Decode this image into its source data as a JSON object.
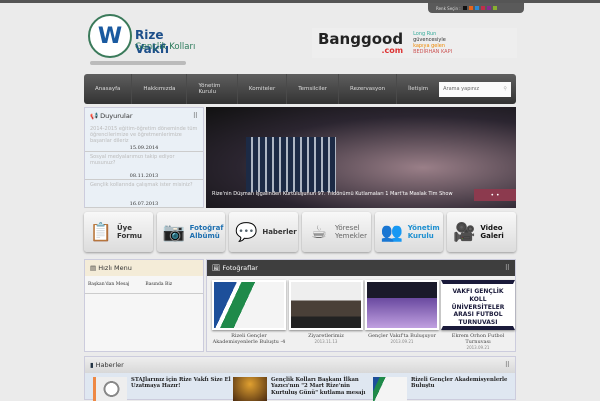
{
  "header": {
    "color_label": "Renk Seçin :",
    "swatches": [
      "#111111",
      "#e8641b",
      "#2a8ad6",
      "#c0304a",
      "#8a2a90",
      "#8ab030"
    ],
    "logo_title": "Rize Vakfı",
    "logo_subtitle": "Gençlik Kolları",
    "ad_brand": "Banggood",
    "ad_domain": ".com",
    "ad_slogan": [
      "Long Run",
      "güvencesiyle",
      "kapıya gelen",
      "BEDİRHAN KAPI"
    ]
  },
  "nav": {
    "items": [
      "Anasayfa",
      "Hakkımızda",
      "Yönetim Kurulu",
      "Komiteler",
      "Temsilciler",
      "Rezervasyon",
      "İletişim"
    ],
    "search_placeholder": "Arama yapınız"
  },
  "announcements": {
    "title": "Duyurular",
    "items": [
      {
        "text": "2014-2015 eğitim-öğretim döneminde tüm öğrencilerimize ve öğretmenlerimize başarılar dileriz",
        "date": "15.09.2014"
      },
      {
        "text": "Sosyal medyalarımızı takip ediyor musunuz?",
        "date": "08.11.2013"
      },
      {
        "text": "Gençlik kollarında çalışmak ister misiniz?",
        "date": "16.07.2013"
      }
    ]
  },
  "slider": {
    "caption": "Rize'nin Düşman İşgalinden Kurtuluşunun 97. Yıldönümü Kutlamaları 1 Mart'ta Maslak Tim Show",
    "dots": "• •"
  },
  "quick_buttons": [
    {
      "l1": "Üye",
      "l2": "Formu",
      "icon": "form-icon",
      "glyph": "📋",
      "color": "#333"
    },
    {
      "l1": "Fotoğraf",
      "l2": "Albümü",
      "icon": "camera-icon",
      "glyph": "📷",
      "color": "#1d6fb0"
    },
    {
      "l1": "Haberler",
      "l2": "",
      "icon": "news-bubble-icon",
      "glyph": "💬",
      "color": "#333"
    },
    {
      "l1": "Yöresel",
      "l2": "Yemekler",
      "icon": "tea-cup-icon",
      "glyph": "☕",
      "color": "#666"
    },
    {
      "l1": "Yönetim",
      "l2": "Kurulu",
      "icon": "people-icon",
      "glyph": "👥",
      "color": "#1d8fd0"
    },
    {
      "l1": "Video",
      "l2": "Galeri",
      "icon": "video-camera-icon",
      "glyph": "🎥",
      "color": "#111"
    }
  ],
  "quick_menu": {
    "title": "Hızlı Menu",
    "links": [
      "Başkan'dan Mesaj",
      "Basında Biz"
    ]
  },
  "photos": {
    "title": "Fotoğraflar",
    "items": [
      {
        "title": "Rizeli Gençler Akademisyenlerle Buluştu -4",
        "date": ""
      },
      {
        "title": "Ziyaretlerimiz",
        "date": "2013.11.13"
      },
      {
        "title": "Gençler Vakıf'ta Buluşuyor",
        "date": "2013.09.21"
      },
      {
        "title": "Ekrem Orhon Futbol Turnuvası",
        "date": "2013.09.21"
      }
    ],
    "banner_text": "VAKFI GENÇLİK KOLL ÜNİVERSİTELER ARASI FUTBOL TURNUVASI"
  },
  "news": {
    "title": "Haberler",
    "items": [
      "STAJlarınız için Rize Vakfı Size El Uzatmaya Hazır!",
      "Gençlik Kolları Başkanı İlkan Yazıcı'nın \"2 Mart Rize'nin Kurtuluş Günü\" kutlama mesajı",
      "Rizeli Gençler Akademisyenlerle Buluştu"
    ]
  }
}
